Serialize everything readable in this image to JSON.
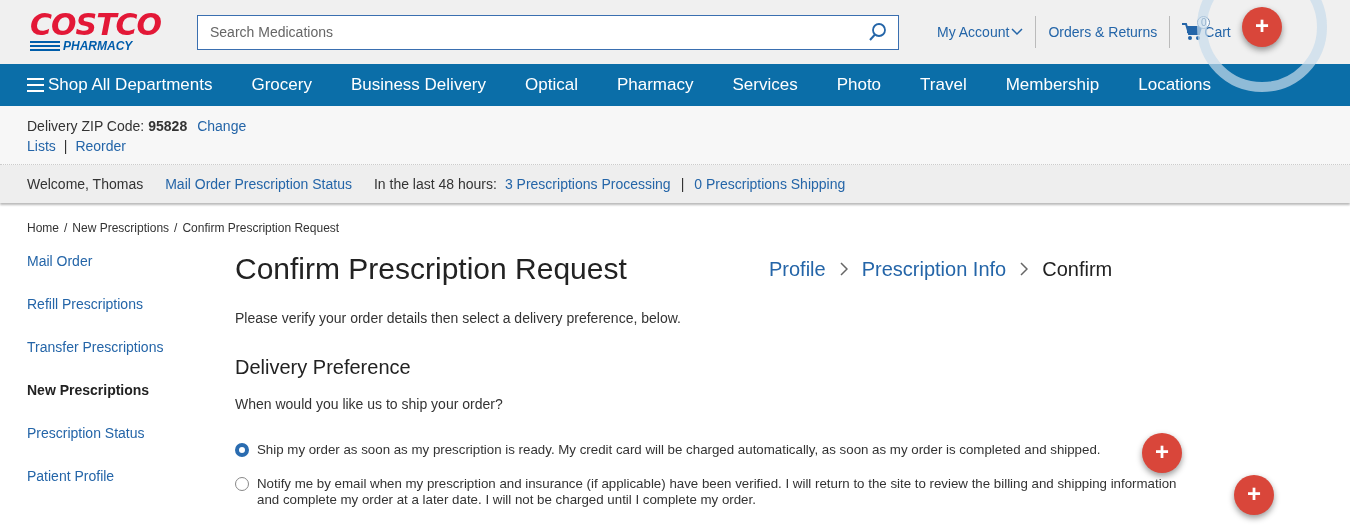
{
  "logo": {
    "brand": "COSTCO",
    "sub": "PHARMACY"
  },
  "search": {
    "placeholder": "Search Medications"
  },
  "header_links": [
    {
      "label": "My Account",
      "kind": "dropdown"
    },
    {
      "label": "Orders & Returns",
      "kind": "link"
    },
    {
      "label": "Cart",
      "kind": "cart",
      "count": "0"
    }
  ],
  "nav": [
    {
      "label": "Shop All Departments",
      "kind": "menu"
    },
    {
      "label": "Grocery",
      "kind": "link"
    },
    {
      "label": "Business Delivery",
      "kind": "link"
    },
    {
      "label": "Optical",
      "kind": "link"
    },
    {
      "label": "Pharmacy",
      "kind": "link"
    },
    {
      "label": "Services",
      "kind": "link"
    },
    {
      "label": "Photo",
      "kind": "link"
    },
    {
      "label": "Travel",
      "kind": "link"
    },
    {
      "label": "Membership",
      "kind": "link"
    },
    {
      "label": "Locations",
      "kind": "link"
    }
  ],
  "delivery": {
    "label": "Delivery ZIP Code:",
    "zip": "95828",
    "change": "Change",
    "links": [
      "Lists",
      "Reorder"
    ],
    "separator": "|"
  },
  "welcome_bar": {
    "greeting": "Welcome, Thomas",
    "status_link": "Mail Order Prescription Status",
    "period": "In the last 48 hours:",
    "counts": [
      "3 Prescriptions Processing",
      "0 Prescriptions Shipping"
    ],
    "separator": "|"
  },
  "breadcrumb": {
    "items": [
      "Home",
      "New Prescriptions",
      "Confirm Prescription Request"
    ],
    "separator": "/"
  },
  "sidebar": [
    {
      "label": "Mail Order",
      "selected": false
    },
    {
      "label": "Refill Prescriptions",
      "selected": false
    },
    {
      "label": "Transfer Prescriptions",
      "selected": false
    },
    {
      "label": "New Prescriptions",
      "selected": true
    },
    {
      "label": "Prescription Status",
      "selected": false
    },
    {
      "label": "Patient Profile",
      "selected": false
    }
  ],
  "title": "Confirm Prescription Request",
  "steps": [
    {
      "label": "Profile",
      "selected": false
    },
    {
      "label": "Prescription Info",
      "selected": false
    },
    {
      "label": "Confirm",
      "selected": true
    }
  ],
  "intro": "Please verify your order details then select a delivery preference, below.",
  "section_title": "Delivery Preference",
  "question": "When would you like us to ship your order?",
  "options": [
    {
      "label": "Ship my order as soon as my prescription is ready. My credit card will be charged automatically, as soon as my order is completed and shipped.",
      "selected": true
    },
    {
      "label": "Notify me by email when my prescription and insurance (if applicable) have been verified. I will return to the site to review the billing and shipping information and complete my order at a later date. I will not be charged until I complete my order.",
      "selected": false
    }
  ],
  "hotspots": [
    {
      "label": "+",
      "pulse": true
    },
    {
      "label": "+",
      "pulse": false
    },
    {
      "label": "+",
      "pulse": false
    }
  ]
}
